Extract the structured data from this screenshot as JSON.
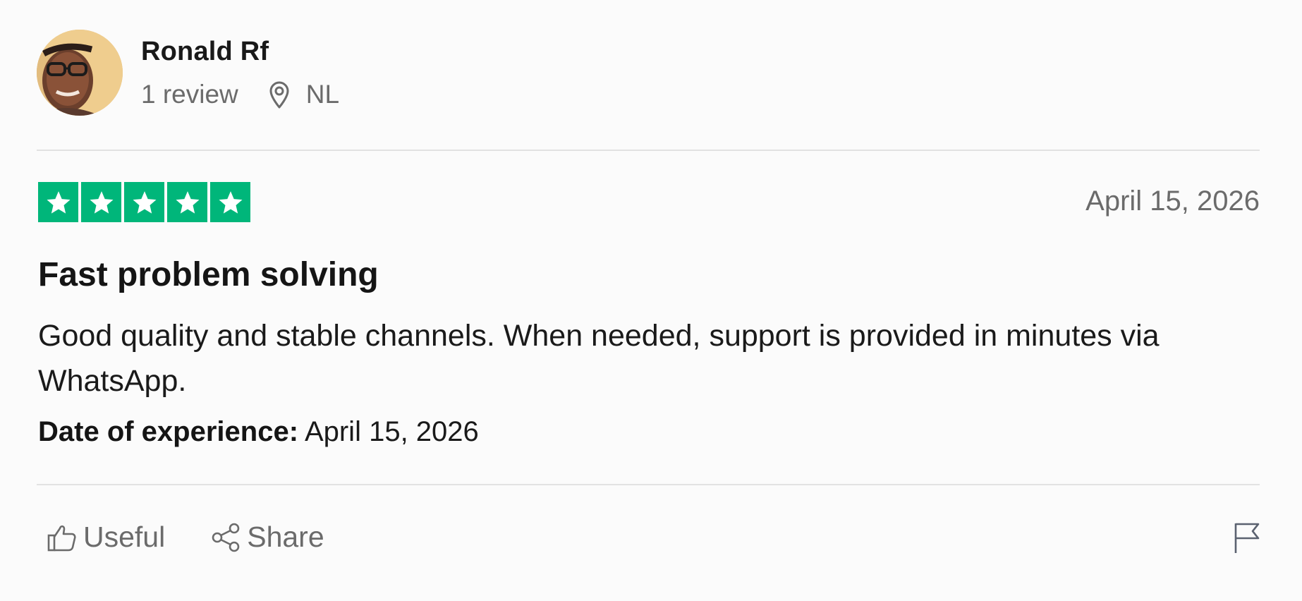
{
  "reviewer": {
    "name": "Ronald Rf",
    "review_count": "1 review",
    "location": "NL"
  },
  "rating": {
    "stars": 5,
    "max": 5,
    "star_color": "#00b67a"
  },
  "review": {
    "date": "April 15, 2026",
    "title": "Fast problem solving",
    "body": "Good quality and stable channels. When needed, support is provided in minutes via WhatsApp.",
    "experience_label": "Date of experience:",
    "experience_value": "April 15, 2026"
  },
  "actions": {
    "useful_label": "Useful",
    "share_label": "Share"
  },
  "icons": {
    "location": "map-pin-icon",
    "useful": "thumbs-up-icon",
    "share": "share-icon",
    "report": "flag-icon"
  }
}
